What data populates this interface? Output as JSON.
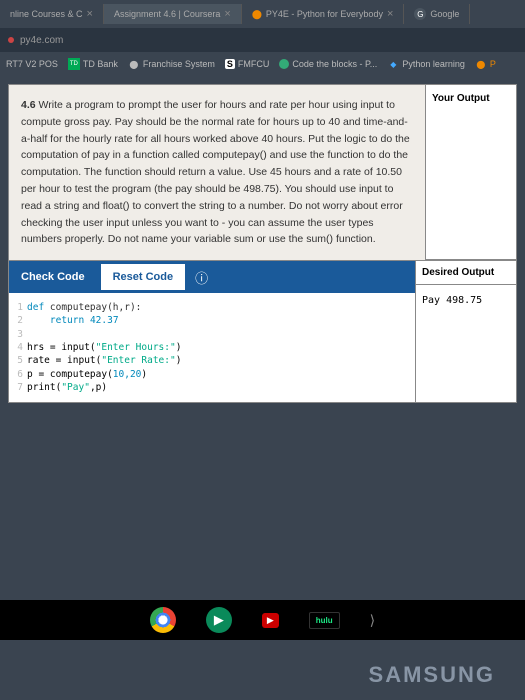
{
  "tabs": [
    {
      "label": "nline Courses & C",
      "close": "×"
    },
    {
      "label": "Assignment 4.6 | Coursera",
      "close": "×"
    },
    {
      "label": "PY4E - Python for Everybody",
      "close": "×"
    },
    {
      "label": "Google"
    }
  ],
  "urlbar": {
    "domain": "py4e.com"
  },
  "bookmarks": [
    {
      "label": "RT7 V2 POS"
    },
    {
      "label": "TD Bank"
    },
    {
      "label": "Franchise System"
    },
    {
      "label": "FMFCU"
    },
    {
      "label": "Code the blocks - P..."
    },
    {
      "label": "Python learning"
    },
    {
      "label": "P"
    }
  ],
  "panel": {
    "your_output_hdr": "Your Output",
    "desired_hdr": "Desired Output",
    "desired_val": "Pay 498.75",
    "check_btn": "Check Code",
    "reset_btn": "Reset Code",
    "instructions_num": "4.6",
    "instructions": "Write a program to prompt the user for hours and rate per hour using input to compute gross pay. Pay should be the normal rate for hours up to 40 and time-and-a-half for the hourly rate for all hours worked above 40 hours. Put the logic to do the computation of pay in a function called computepay() and use the function to do the computation. The function should return a value. Use 45 hours and a rate of 10.50 per hour to test the program (the pay should be 498.75). You should use input to read a string and float() to convert the string to a number. Do not worry about error checking the user input unless you want to - you can assume the user types numbers properly. Do not name your variable sum or use the sum() function."
  },
  "code": {
    "l1_kw": "def",
    "l1_fn": " computepay(h,r):",
    "l2_kw": "return",
    "l2_num": " 42.37",
    "l4_a": "hrs = input(",
    "l4_s": "\"Enter Hours:\"",
    "l4_b": ")",
    "l5_a": "rate = input(",
    "l5_s": "\"Enter Rate:\"",
    "l5_b": ")",
    "l6_a": "p = computepay(",
    "l6_n": "10,20",
    "l6_b": ")",
    "l7_a": "print(",
    "l7_s": "\"Pay\"",
    "l7_b": ",p)"
  },
  "nav": {
    "hulu": "hulu"
  },
  "brand": "SAMSUNG"
}
